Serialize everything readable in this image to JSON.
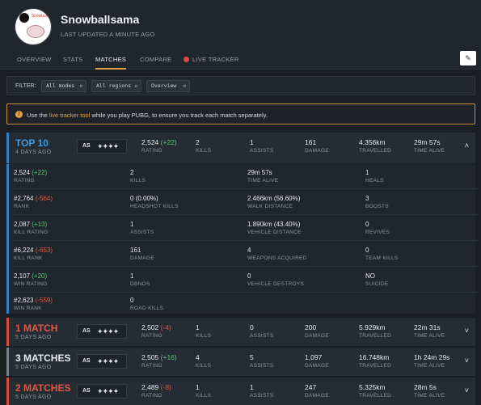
{
  "profile": {
    "username": "Snowballsama",
    "updated": "LAST UPDATED A MINUTE AGO",
    "avatar_tag": "Snowball"
  },
  "nav": {
    "tabs": [
      "OVERVIEW",
      "STATS",
      "MATCHES",
      "COMPARE",
      "LIVE TRACKER"
    ],
    "active": "MATCHES",
    "edit_icon": "pencil-icon"
  },
  "filter": {
    "label": "FILTER:",
    "mode": "All modes",
    "region": "All regions",
    "view": "Overview"
  },
  "notice": {
    "pre": "Use the ",
    "link": "live tracker tool",
    "post": " while you play PUBG, to ensure you track each match separately."
  },
  "colors": {
    "accent": "#e3a341",
    "top10": "#3f9ae0",
    "loss": "#e05846",
    "positive": "#5cc77a",
    "negative": "#e05846"
  },
  "matches": [
    {
      "title": "TOP 10",
      "ago": "4 DAYS AGO",
      "as": "AS",
      "rating": "2,524",
      "rating_delta": "(+22)",
      "rating_label": "RATING",
      "kills": "2",
      "kills_label": "KILLS",
      "assists": "1",
      "assists_label": "ASSISTS",
      "damage": "161",
      "damage_label": "DAMAGE",
      "travelled": "4.356km",
      "travelled_label": "TRAVELLED",
      "time": "29m 57s",
      "time_label": "TIME ALIVE",
      "toggle": "˄"
    },
    {
      "title": "1 MATCH",
      "ago": "5 DAYS AGO",
      "as": "AS",
      "rating": "2,502",
      "rating_delta": "(-4)",
      "rating_label": "RATING",
      "kills": "1",
      "kills_label": "KILLS",
      "assists": "0",
      "assists_label": "ASSISTS",
      "damage": "200",
      "damage_label": "DAMAGE",
      "travelled": "5.929km",
      "travelled_label": "TRAVELLED",
      "time": "22m 31s",
      "time_label": "TIME ALIVE",
      "toggle": "˅"
    },
    {
      "title": "3 MATCHES",
      "ago": "5 DAYS AGO",
      "as": "AS",
      "rating": "2,505",
      "rating_delta": "(+16)",
      "rating_label": "RATING",
      "kills": "4",
      "kills_label": "KILLS",
      "assists": "5",
      "assists_label": "ASSISTS",
      "damage": "1,097",
      "damage_label": "DAMAGE",
      "travelled": "16.748km",
      "travelled_label": "TRAVELLED",
      "time": "1h 24m 29s",
      "time_label": "TIME ALIVE",
      "toggle": "˅"
    },
    {
      "title": "2 MATCHES",
      "ago": "5 DAYS AGO",
      "as": "AS",
      "rating": "2,489",
      "rating_delta": "(-8)",
      "rating_label": "RATING",
      "kills": "1",
      "kills_label": "KILLS",
      "assists": "1",
      "assists_label": "ASSISTS",
      "damage": "247",
      "damage_label": "DAMAGE",
      "travelled": "5.325km",
      "travelled_label": "TRAVELLED",
      "time": "28m 5s",
      "time_label": "TIME ALIVE",
      "toggle": "˅"
    }
  ],
  "detail": {
    "col1": [
      {
        "v": "2,524",
        "d": "(+22)",
        "l": "RATING"
      },
      {
        "v": "#2,764",
        "d": "(-564)",
        "l": "RANK"
      },
      {
        "v": "2,087",
        "d": "(+13)",
        "l": "KILL RATING"
      },
      {
        "v": "#6,224",
        "d": "(-653)",
        "l": "KILL RANK"
      },
      {
        "v": "2,107",
        "d": "(+20)",
        "l": "WIN RATING"
      },
      {
        "v": "#2,623",
        "d": "(-559)",
        "l": "WIN RANK"
      }
    ],
    "col2": [
      {
        "v": "2",
        "l": "KILLS"
      },
      {
        "v": "0",
        "d": "(0.00%)",
        "l": "HEADSHOT KILLS"
      },
      {
        "v": "1",
        "l": "ASSISTS"
      },
      {
        "v": "161",
        "l": "DAMAGE"
      },
      {
        "v": "1",
        "l": "DBNOS"
      },
      {
        "v": "0",
        "l": "ROAD KILLS"
      }
    ],
    "col3": [
      {
        "v": "29m 57s",
        "l": "TIME ALIVE"
      },
      {
        "v": "2.466km",
        "d": "(56.60%)",
        "l": "WALK DISTANCE"
      },
      {
        "v": "1.890km",
        "d": "(43.40%)",
        "l": "VEHICLE DISTANCE"
      },
      {
        "v": "4",
        "l": "WEAPONS ACQUIRED"
      },
      {
        "v": "0",
        "l": "VEHICLE DESTROYS"
      }
    ],
    "col4": [
      {
        "v": "1",
        "l": "HEALS"
      },
      {
        "v": "3",
        "l": "BOOSTS"
      },
      {
        "v": "0",
        "l": "REVIVES"
      },
      {
        "v": "0",
        "l": "TEAM KILLS"
      },
      {
        "v": "NO",
        "l": "SUICIDE"
      }
    ]
  }
}
